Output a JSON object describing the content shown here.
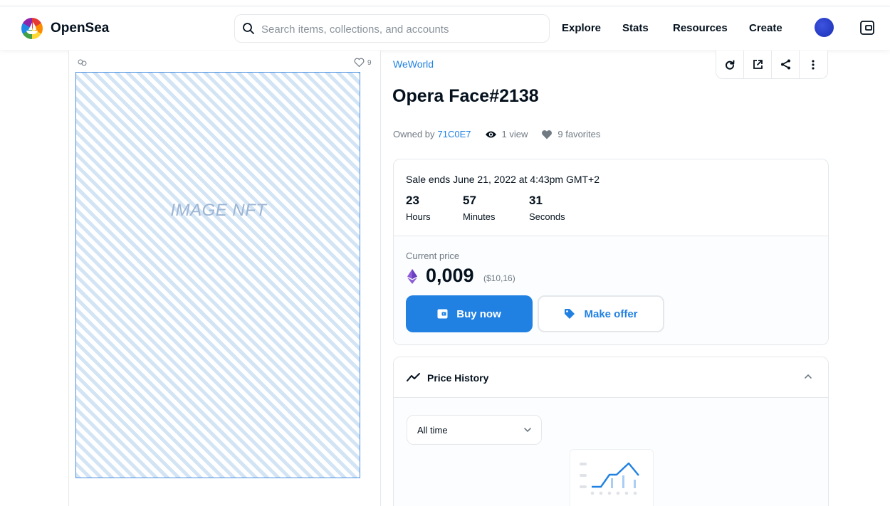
{
  "nav": {
    "brand": "OpenSea",
    "search_placeholder": "Search items, collections, and accounts",
    "links": [
      "Explore",
      "Stats",
      "Resources",
      "Create"
    ]
  },
  "asset_panel": {
    "favorites_count": "9",
    "image_label": "IMAGE NFT"
  },
  "item": {
    "collection": "WeWorld",
    "title": "Opera Face#2138",
    "owned_by_label": "Owned by",
    "owner": "71C0E7",
    "views": "1 view",
    "favorites": "9 favorites"
  },
  "sale": {
    "ends_text": "Sale ends June 21, 2022 at 4:43pm GMT+2",
    "countdown": [
      {
        "value": "23",
        "unit": "Hours"
      },
      {
        "value": "57",
        "unit": "Minutes"
      },
      {
        "value": "31",
        "unit": "Seconds"
      }
    ],
    "current_price_label": "Current price",
    "price": "0,009",
    "price_usd": "($10,16)",
    "buy_label": "Buy now",
    "offer_label": "Make offer"
  },
  "price_history": {
    "title": "Price History",
    "range_selected": "All time"
  },
  "colors": {
    "accent": "#2081e2",
    "text": "#04111d",
    "muted": "#707a83",
    "border": "#e5e8eb",
    "eth": "#8c5cd6"
  }
}
